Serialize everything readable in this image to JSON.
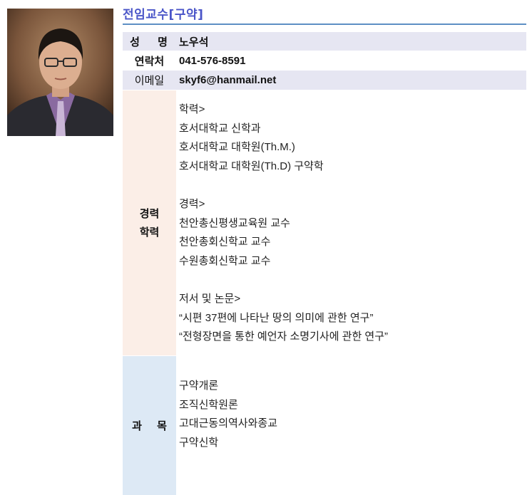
{
  "title": "전임교수[구약]",
  "name": {
    "label": "성 명",
    "value": "노우석"
  },
  "phone": {
    "label": "연락처",
    "value": "041-576-8591"
  },
  "email": {
    "label": "이메일",
    "value": "skyf6@hanmail.net"
  },
  "career": {
    "label_line1": "경력",
    "label_line2": "학력",
    "education_header": "학력>",
    "education": [
      "호서대학교 신학과",
      "호서대학교 대학원(Th.M.)",
      "호서대학교 대학원(Th.D) 구약학"
    ],
    "experience_header": "경력>",
    "experience": [
      "천안총신평생교육원 교수",
      "천안총회신학교 교수",
      "수원총회신학교 교수"
    ],
    "publications_header": "저서 및 논문>",
    "publications": [
      "“시편 37편에 나타난 땅의 의미에 관한 연구”",
      "“전형장면을 통한 예언자 소명기사에 관한 연구”"
    ]
  },
  "courses": {
    "label": "과 목",
    "items": [
      "구약개론",
      "조직신학원론",
      "고대근동의역사와종교",
      "구약신학"
    ]
  }
}
